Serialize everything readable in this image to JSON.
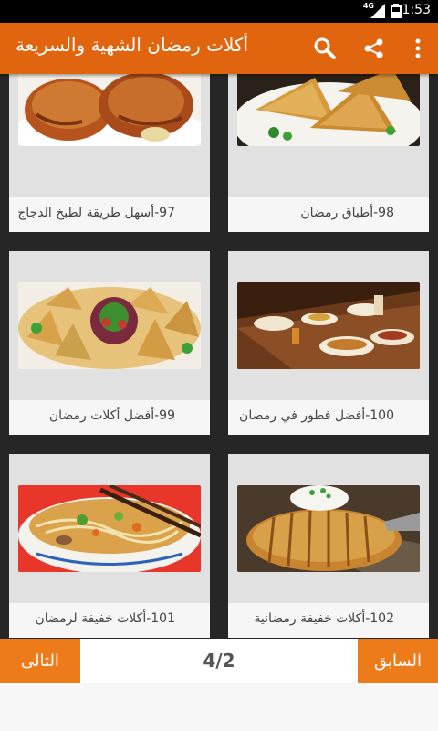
{
  "status_bar": {
    "time": "1:53",
    "network": "4G"
  },
  "app_bar": {
    "title": "أكلات رمضان الشهية والسريعة",
    "icons": [
      "search-icon",
      "share-icon",
      "more-vert-icon"
    ]
  },
  "colors": {
    "accent": "#e1650f",
    "button": "#ee7b19",
    "grid_bg": "#262626"
  },
  "recipes": [
    {
      "caption": "97-أسهل طريقة لطبخ الدجاج",
      "image": "roast-chicken"
    },
    {
      "caption": "98-أطباق رمضان",
      "image": "samosa-plate"
    },
    {
      "caption": "99-أفضل أكلات رمضان",
      "image": "samosa-platter"
    },
    {
      "caption": "100-أفضل فطور في رمضان",
      "image": "iftar-table"
    },
    {
      "caption": "101-أكلات خفيفة لرمضان",
      "image": "noodle-soup"
    },
    {
      "caption": "102-أكلات خفيفة رمضانية",
      "image": "hasselback-potato"
    }
  ],
  "pagination": {
    "next_label": "التالى",
    "prev_label": "السابق",
    "page": "4/2"
  }
}
